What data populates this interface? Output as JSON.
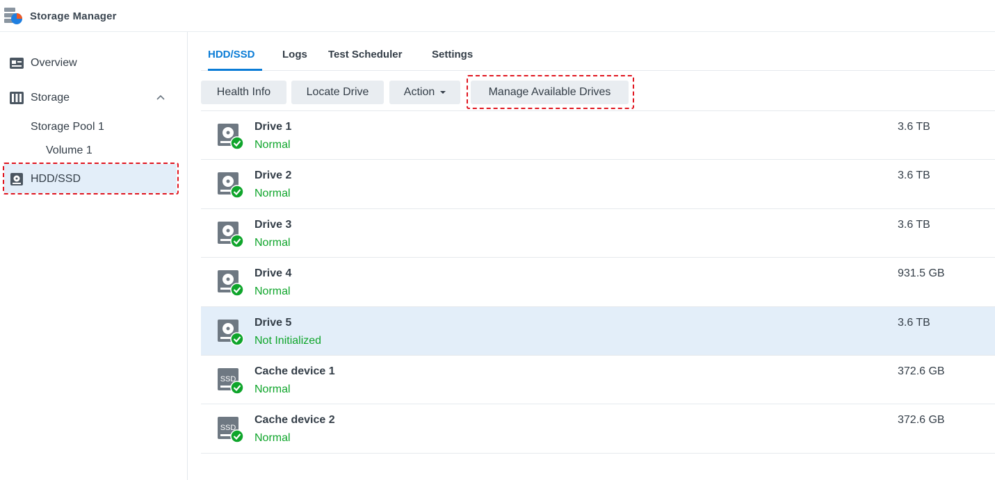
{
  "app": {
    "title": "Storage Manager",
    "icon": "storage-manager-icon"
  },
  "sidebar": {
    "items": [
      {
        "label": "Overview",
        "icon": "overview-icon"
      },
      {
        "label": "Storage",
        "icon": "storage-icon"
      },
      {
        "label": "Storage Pool 1"
      },
      {
        "label": "Volume 1"
      },
      {
        "label": "HDD/SSD",
        "icon": "hdd-icon",
        "selected": true
      }
    ]
  },
  "tabs": [
    {
      "label": "HDD/SSD",
      "active": true
    },
    {
      "label": "Logs"
    },
    {
      "label": "Test Scheduler"
    },
    {
      "label": "Settings"
    }
  ],
  "toolbar": {
    "health_info": "Health Info",
    "locate_drive": "Locate Drive",
    "action": "Action",
    "manage_drives": "Manage Available Drives"
  },
  "drives": [
    {
      "name": "Drive 1",
      "status": "Normal",
      "size": "3.6 TB",
      "type": "hdd"
    },
    {
      "name": "Drive 2",
      "status": "Normal",
      "size": "3.6 TB",
      "type": "hdd"
    },
    {
      "name": "Drive 3",
      "status": "Normal",
      "size": "3.6 TB",
      "type": "hdd"
    },
    {
      "name": "Drive 4",
      "status": "Normal",
      "size": "931.5 GB",
      "type": "hdd"
    },
    {
      "name": "Drive 5",
      "status": "Not Initialized",
      "size": "3.6 TB",
      "type": "hdd",
      "selected": true
    },
    {
      "name": "Cache device 1",
      "status": "Normal",
      "size": "372.6 GB",
      "type": "ssd",
      "badge": "SSD"
    },
    {
      "name": "Cache device 2",
      "status": "Normal",
      "size": "372.6 GB",
      "type": "ssd",
      "badge": "SSD"
    }
  ],
  "colors": {
    "accent": "#0a7cd6",
    "ok": "#0fa52b",
    "highlight": "#e0141e",
    "selected_bg": "#e3eef9"
  }
}
